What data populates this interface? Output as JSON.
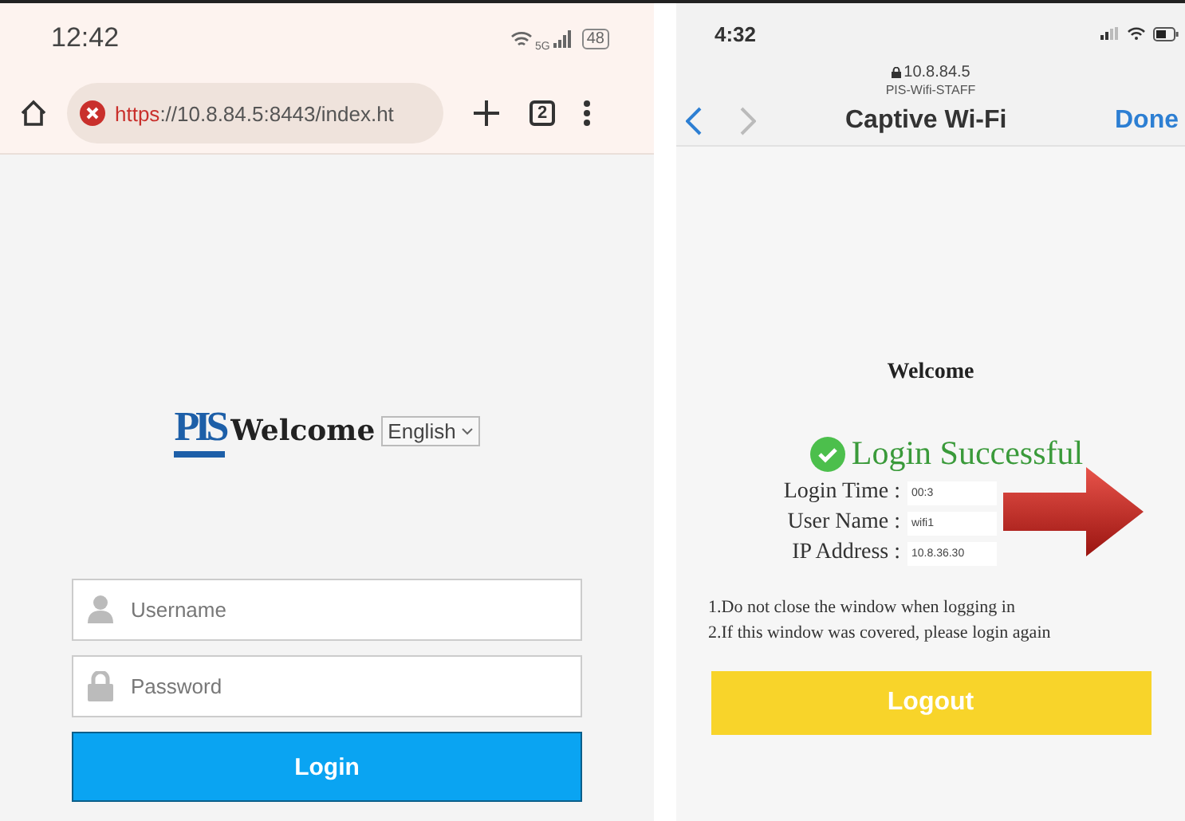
{
  "left_phone": {
    "status_bar": {
      "time": "12:42",
      "network": "5G",
      "battery": "48"
    },
    "browser_bar": {
      "url_scheme": "https",
      "url_rest": "://10.8.84.5:8443/index.ht",
      "tab_count": "2"
    },
    "page": {
      "logo": "PIS",
      "title": "Welcome",
      "language": "English",
      "username_placeholder": "Username",
      "password_placeholder": "Password",
      "login_button": "Login"
    }
  },
  "right_phone": {
    "status_bar": {
      "time": "4:32"
    },
    "header": {
      "address": "10.8.84.5",
      "network_name": "PIS-Wifi-STAFF",
      "title": "Captive Wi-Fi",
      "done": "Done"
    },
    "page": {
      "title": "Welcome",
      "status": "Login Successful",
      "fields": [
        {
          "label": "Login Time :",
          "value": "00:3"
        },
        {
          "label": "User Name :",
          "value": "wifi1"
        },
        {
          "label": "IP Address :",
          "value": "10.8.36.30"
        }
      ],
      "notes": [
        "1.Do not close the window when logging in",
        "2.If this window was covered, please login again"
      ],
      "logout_button": "Logout"
    }
  }
}
